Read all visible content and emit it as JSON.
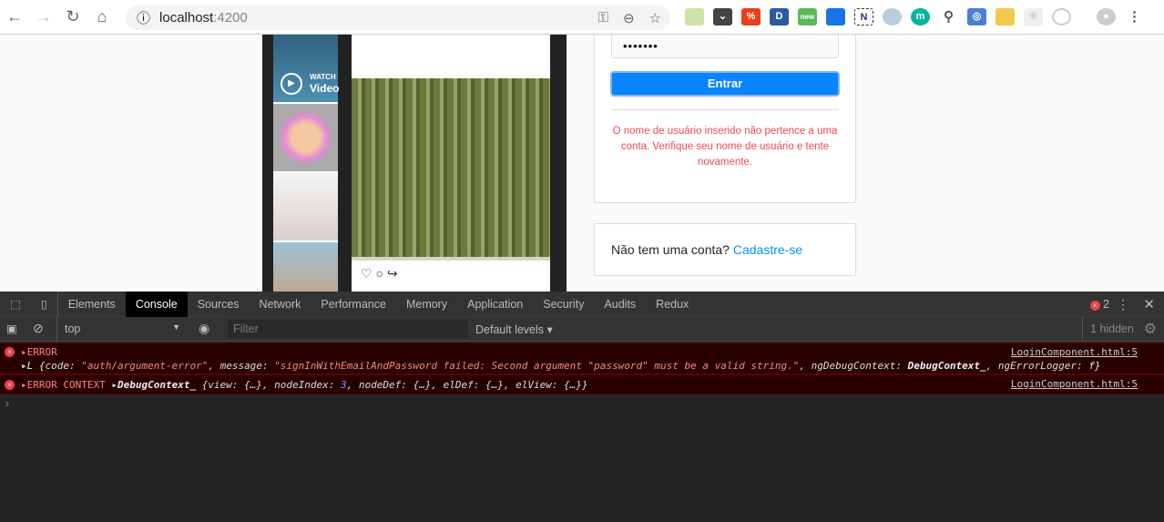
{
  "browser": {
    "url_host": "localhost",
    "url_port": ":4200",
    "extension_icons": [
      "notepad",
      "pocket",
      "extension-red",
      "d-extension",
      "new-extension",
      "lighthouse",
      "n-extension",
      "astronaut",
      "m-extension",
      "search",
      "camera",
      "color-picker",
      "react-devtools",
      "redux-devtools"
    ],
    "new_badge": "new"
  },
  "login": {
    "password_mask": "•••••••",
    "submit_label": "Entrar",
    "error_message": "O nome de usuário inserido não pertence a uma conta. Verifique seu nome de usuário e tente novamente.",
    "signup_prompt": "Não tem uma conta?",
    "signup_link": "Cadastre-se",
    "watch_label": "WATCH",
    "video_label": "Video"
  },
  "devtools": {
    "tabs": [
      "Elements",
      "Console",
      "Sources",
      "Network",
      "Performance",
      "Memory",
      "Application",
      "Security",
      "Audits",
      "Redux"
    ],
    "active_tab": "Console",
    "error_count": "2",
    "context": "top",
    "filter_placeholder": "Filter",
    "levels": "Default levels ▾",
    "hidden": "1 hidden",
    "messages": [
      {
        "label": "ERROR",
        "source": "LoginComponent.html:5",
        "detail": {
          "prefix": "L {",
          "code_key": "code: ",
          "code_val": "\"auth/argument-error\"",
          "msg_key": ", message: ",
          "msg_val": "\"signInWithEmailAndPassword failed: Second argument \"password\" must be a valid string.\"",
          "ctx_key": ", ngDebugContext: ",
          "ctx_val": "DebugContext_",
          "logger": ", ngErrorLogger: ",
          "logger_val": "f}"
        }
      },
      {
        "label": "ERROR CONTEXT",
        "source": "LoginComponent.html:5",
        "detail": {
          "name": "DebugContext_",
          "a": " {view: {…}, nodeIndex: ",
          "idx": "3",
          "b": ", nodeDef: {…}, elDef: {…}, elView: {…}}"
        }
      }
    ]
  },
  "colors": {
    "accent": "#0a84ff",
    "error_text": "#ed4956",
    "console_error_bg": "#290000"
  }
}
